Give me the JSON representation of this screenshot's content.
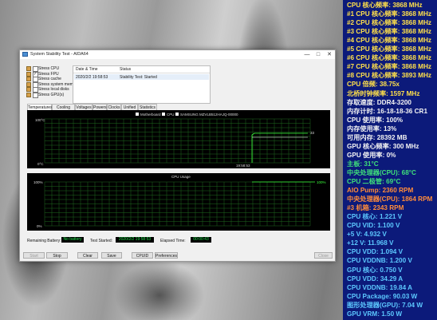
{
  "window": {
    "title": "System Stability Test - AIDA64",
    "minimize": "—",
    "maximize": "□",
    "close": "✕"
  },
  "stress_options": [
    {
      "label": "Stress CPU",
      "checked": false
    },
    {
      "label": "Stress FPU",
      "checked": true
    },
    {
      "label": "Stress cache",
      "checked": false
    },
    {
      "label": "Stress system memory",
      "checked": false
    },
    {
      "label": "Stress local disks",
      "checked": false
    },
    {
      "label": "Stress GPU(s)",
      "checked": false
    }
  ],
  "log": {
    "headers": [
      "Date & Time",
      "Status"
    ],
    "rows": [
      {
        "date": "2020/2/2 19:58:53",
        "status": "Stability Test: Started"
      }
    ]
  },
  "tabs": [
    "Temperatures",
    "Cooling Fans",
    "Voltages",
    "Powers",
    "Clocks",
    "Unified",
    "Statistics"
  ],
  "temp_graph": {
    "legend": [
      "Motherboard",
      "CPU",
      "SAMSUNG MZVLB512HAJQ-00000"
    ],
    "y_top": "100°C",
    "y_bottom": "0°C",
    "time_label": "19:58:53",
    "end_value": "33",
    "colors": {
      "motherboard": "#ffffff",
      "cpu": "#3cff3c",
      "ssd": "#ffffff"
    }
  },
  "cpu_graph": {
    "title": "CPU Usage",
    "y_top": "100%",
    "y_bottom": "0%",
    "right_top": "100%"
  },
  "status": {
    "battery_label": "Remaining Battery:",
    "battery_value": "No battery",
    "started_label": "Test Started:",
    "started_value": "2020/2/2 19:58:53",
    "elapsed_label": "Elapsed Time:",
    "elapsed_value": "00:00:43"
  },
  "buttons": {
    "start": "Start",
    "stop": "Stop",
    "clear": "Clear",
    "save": "Save",
    "cpuid": "CPUID",
    "preferences": "Preferences",
    "close": "Close"
  },
  "osd_lines": [
    {
      "text": "CPU 核心频率: 3868 MHz",
      "color": "#ffe04a"
    },
    {
      "text": "#1 CPU 核心频率: 3868 MHz",
      "color": "#ffe04a"
    },
    {
      "text": "#2 CPU 核心频率: 3868 MHz",
      "color": "#ffe04a"
    },
    {
      "text": "#3 CPU 核心频率: 3868 MHz",
      "color": "#ffe04a"
    },
    {
      "text": "#4 CPU 核心频率: 3868 MHz",
      "color": "#ffe04a"
    },
    {
      "text": "#5 CPU 核心频率: 3868 MHz",
      "color": "#ffe04a"
    },
    {
      "text": "#6 CPU 核心频率: 3868 MHz",
      "color": "#ffe04a"
    },
    {
      "text": "#7 CPU 核心频率: 3868 MHz",
      "color": "#ffe04a"
    },
    {
      "text": "#8 CPU 核心频率: 3893 MHz",
      "color": "#ffe04a"
    },
    {
      "text": "CPU 倍频: 38.75x",
      "color": "#ffe04a"
    },
    {
      "text": "北桥时钟频率: 1597 MHz",
      "color": "#ffe04a"
    },
    {
      "text": "存取速度: DDR4-3200",
      "color": "#f4f4f4"
    },
    {
      "text": "内存计时: 16-18-18-36 CR1",
      "color": "#f4f4f4"
    },
    {
      "text": "CPU 使用率: 100%",
      "color": "#f4f4f4"
    },
    {
      "text": "内存使用率: 13%",
      "color": "#f4f4f4"
    },
    {
      "text": "可用内存: 28392 MB",
      "color": "#f4f4f4"
    },
    {
      "text": "GPU 核心频率: 300 MHz",
      "color": "#f4f4f4"
    },
    {
      "text": "GPU 使用率: 0%",
      "color": "#f4f4f4"
    },
    {
      "text": "主板: 31°C",
      "color": "#3fe07a"
    },
    {
      "text": "中央处理器(CPU): 68°C",
      "color": "#3fe07a"
    },
    {
      "text": "CPU 二极管: 69°C",
      "color": "#3fe07a"
    },
    {
      "text": "AIO Pump: 2360 RPM",
      "color": "#ff8c3a"
    },
    {
      "text": "中央处理器(CPU): 1864 RPM",
      "color": "#ff8c3a"
    },
    {
      "text": "#3 机箱: 2343 RPM",
      "color": "#ff8c3a"
    },
    {
      "text": "CPU 核心: 1.221 V",
      "color": "#5cc8ff"
    },
    {
      "text": "CPU VID: 1.100 V",
      "color": "#5cc8ff"
    },
    {
      "text": "+5 V: 4.932 V",
      "color": "#5cc8ff"
    },
    {
      "text": "+12 V: 11.968 V",
      "color": "#5cc8ff"
    },
    {
      "text": "CPU VDD: 1.094 V",
      "color": "#5cc8ff"
    },
    {
      "text": "CPU VDDNB: 1.200 V",
      "color": "#5cc8ff"
    },
    {
      "text": "GPU 核心: 0.750 V",
      "color": "#5cc8ff"
    },
    {
      "text": "CPU VDD: 34.29 A",
      "color": "#5cc8ff"
    },
    {
      "text": "CPU VDDNB: 19.84 A",
      "color": "#5cc8ff"
    },
    {
      "text": "CPU Package: 90.03 W",
      "color": "#5cc8ff"
    },
    {
      "text": "图形处理器(GPU): 7.04 W",
      "color": "#5cc8ff"
    },
    {
      "text": "GPU VRM: 1.50 W",
      "color": "#5cc8ff"
    }
  ]
}
